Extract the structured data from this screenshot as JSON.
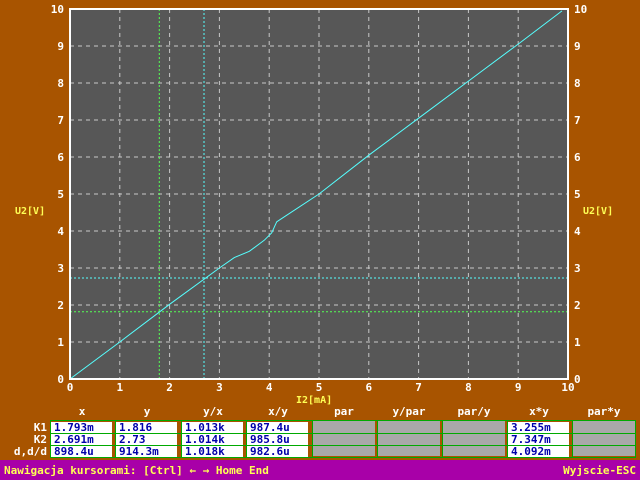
{
  "chart_data": {
    "type": "line",
    "xlabel": "I2[mA]",
    "ylabel": "U2[V]",
    "ylabel_right": "U2[V]",
    "xlim": [
      0,
      10
    ],
    "ylim": [
      0,
      10
    ],
    "x_ticks": [
      "0",
      "1",
      "2",
      "3",
      "4",
      "5",
      "6",
      "7",
      "8",
      "9",
      "10"
    ],
    "y_ticks": [
      "0",
      "1",
      "2",
      "3",
      "4",
      "5",
      "6",
      "7",
      "8",
      "9",
      "10"
    ],
    "grid": true,
    "colors": {
      "background": "#575757",
      "line": "#55ffff",
      "grid": "#c8c8c8",
      "frame": "#ffffff",
      "cursor_k1": "#55ff55",
      "cursor_k2": "#55ffff"
    },
    "series": [
      {
        "x": [
          0,
          1,
          2,
          3,
          3.3,
          3.6,
          3.9,
          4.05,
          4.15,
          4.3,
          5,
          6,
          7,
          8,
          9,
          9.88
        ],
        "y": [
          0,
          1.0,
          2.02,
          3.0,
          3.28,
          3.45,
          3.75,
          3.95,
          4.25,
          4.38,
          5.0,
          6.05,
          7.05,
          8.05,
          9.05,
          9.95
        ]
      }
    ],
    "cursors": [
      {
        "name": "K1",
        "x": 1.793,
        "y": 1.816
      },
      {
        "name": "K2",
        "x": 2.691,
        "y": 2.73
      }
    ]
  },
  "readout": {
    "headers": [
      "x",
      "y",
      "y/x",
      "x/y",
      "par",
      "y/par",
      "par/y",
      "x*y",
      "par*y"
    ],
    "rows": [
      {
        "label": "K1",
        "values": [
          "1.793m",
          "1.816",
          "1.013k",
          "987.4u",
          "",
          "",
          "",
          "3.255m",
          ""
        ]
      },
      {
        "label": "K2",
        "values": [
          "2.691m",
          "2.73",
          "1.014k",
          "985.8u",
          "",
          "",
          "",
          "7.347m",
          ""
        ]
      },
      {
        "label": "d,d/d",
        "values": [
          "898.4u",
          "914.3m",
          "1.018k",
          "982.6u",
          "",
          "",
          "",
          "4.092m",
          ""
        ]
      }
    ]
  },
  "status": {
    "navigation": "Nawigacja kursorami: [Ctrl] ← → Home End",
    "exit": "Wyjscie-ESC"
  }
}
